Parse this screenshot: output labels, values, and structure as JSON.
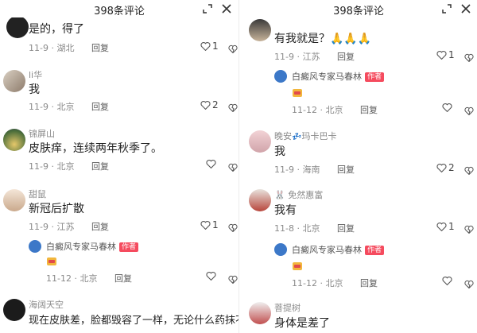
{
  "left": {
    "title": "398条评论",
    "comments": [
      {
        "name": "",
        "text": "是的，得了",
        "meta": "11-9 · 湖北",
        "reply": "回复",
        "likes": "1"
      },
      {
        "name": "li华",
        "text": "我",
        "meta": "11-9 · 北京",
        "reply": "回复",
        "likes": "2"
      },
      {
        "name": "锦屏山",
        "text": "皮肤痒，连续两年秋季了。",
        "meta": "11-9 · 北京",
        "reply": "回复",
        "likes": ""
      },
      {
        "name": "甜鼠",
        "text": "新冠后扩散",
        "meta": "11-9 · 江苏",
        "reply": "回复",
        "likes": "1"
      },
      {
        "name": "白癜风专家马春林",
        "author_tag": "作者",
        "text": "",
        "meta": "11-12 · 北京",
        "reply": "回复",
        "likes": ""
      },
      {
        "name": "海阔天空",
        "text": "现在皮肤差，脸都毁容了一样，无论什么药抹不好",
        "meta": "",
        "reply": "",
        "likes": ""
      }
    ]
  },
  "right": {
    "title": "398条评论",
    "comments": [
      {
        "name": "",
        "text": "有我就是？🙏🙏🙏",
        "meta": "11-9 · 江苏",
        "reply": "回复",
        "likes": "1"
      },
      {
        "name": "白癜风专家马春林",
        "author_tag": "作者",
        "text": "",
        "meta": "11-12 · 北京",
        "reply": "回复",
        "likes": ""
      },
      {
        "name": "晚安",
        "name_suffix": "玛卡巴卡",
        "text": "我",
        "meta": "11-9 · 海南",
        "reply": "回复",
        "likes": "2"
      },
      {
        "name": "免然惠富",
        "text": "我有",
        "meta": "11-8 · 北京",
        "reply": "回复",
        "likes": "1"
      },
      {
        "name": "白癜风专家马春林",
        "author_tag": "作者",
        "text": "",
        "meta": "11-12 · 北京",
        "reply": "回复",
        "likes": ""
      },
      {
        "name": "菩提树",
        "text": "身体是差了",
        "meta": "",
        "reply": "",
        "likes": ""
      }
    ]
  },
  "colors": {
    "author_tag": "#f54b5e",
    "meta": "#8a8a8a",
    "text": "#1f1f1f"
  },
  "icons": [
    "minimize-icon",
    "close-icon",
    "heart-icon",
    "broken-heart-icon",
    "pray-hands-emoji",
    "badge-icon"
  ]
}
